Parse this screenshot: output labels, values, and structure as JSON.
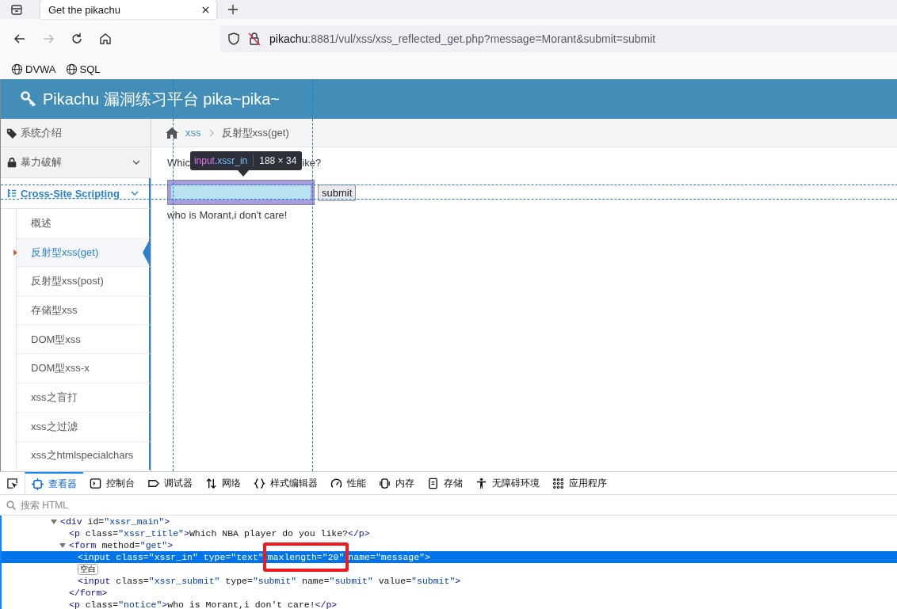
{
  "browser": {
    "tabs": [
      {
        "title": "Get the pikachu",
        "selected": true
      }
    ],
    "nav": {
      "forward_disabled": true
    },
    "url": {
      "host": "pikachu",
      "rest": ":8881/vul/xss/xss_reflected_get.php?message=Morant&submit=submit"
    },
    "bookmarks": [
      {
        "label": "DVWA"
      },
      {
        "label": "SQL"
      }
    ]
  },
  "page": {
    "header_title": "Pikachu 漏洞练习平台 pika~pika~",
    "sidebar": [
      {
        "label": "系统介绍",
        "kind": "plain"
      },
      {
        "label": "暴力破解",
        "kind": "group",
        "expanded": false
      },
      {
        "label": "Cross-Site Scripting",
        "kind": "group",
        "expanded": true,
        "children": [
          {
            "label": "概述",
            "selected": false
          },
          {
            "label": "反射型xss(get)",
            "selected": true
          },
          {
            "label": "反射型xss(post)",
            "selected": false
          },
          {
            "label": "存储型xss",
            "selected": false
          },
          {
            "label": "DOM型xss",
            "selected": false
          },
          {
            "label": "DOM型xss-x",
            "selected": false
          },
          {
            "label": "xss之盲打",
            "selected": false
          },
          {
            "label": "xss之过滤",
            "selected": false
          },
          {
            "label": "xss之htmlspecialchars",
            "selected": false
          }
        ]
      }
    ],
    "breadcrumb": {
      "section": "xss",
      "current": "反射型xss(get)"
    },
    "form": {
      "title_start": "Whic",
      "title_end": "ike?",
      "submit": "submit",
      "notice": "who is Morant,i don't care!"
    },
    "highlighter_tooltip": {
      "tag": "input",
      "class": ".xssr_in",
      "size": "188 × 34"
    }
  },
  "devtools": {
    "tabs": [
      {
        "label": "查看器",
        "selected": true
      },
      {
        "label": "控制台",
        "selected": false
      },
      {
        "label": "调试器",
        "selected": false
      },
      {
        "label": "网络",
        "selected": false
      },
      {
        "label": "样式编辑器",
        "selected": false
      },
      {
        "label": "性能",
        "selected": false
      },
      {
        "label": "内存",
        "selected": false
      },
      {
        "label": "存储",
        "selected": false
      },
      {
        "label": "无障碍环境",
        "selected": false
      },
      {
        "label": "应用程序",
        "selected": false
      }
    ],
    "search_placeholder": "搜索 HTML",
    "tree": [
      {
        "open": "<div id=\"xssr_main\">",
        "expanded": true,
        "children": [
          {
            "open": "<p class=\"xssr_title\">Which NBA player do you like?</p>"
          },
          {
            "open": "<form method=\"get\">",
            "expanded": true,
            "close": "</form>",
            "children": [
              {
                "parts": [
                  {
                    "text": "<input class=\"xssr_in\" type=\"text\" "
                  },
                  {
                    "text": "maxlength=\"20\"",
                    "boxed": true
                  },
                  {
                    "text": " name=\"message\">"
                  }
                ],
                "selected": true
              },
              {
                "kind": "whitespace",
                "open": "空白"
              },
              {
                "open": "<input class=\"xssr_submit\" type=\"submit\" name=\"submit\" value=\"submit\">"
              }
            ]
          },
          {
            "open": "<p class=\"notice\">who is Morant,i don't care!</p>"
          }
        ]
      }
    ]
  }
}
